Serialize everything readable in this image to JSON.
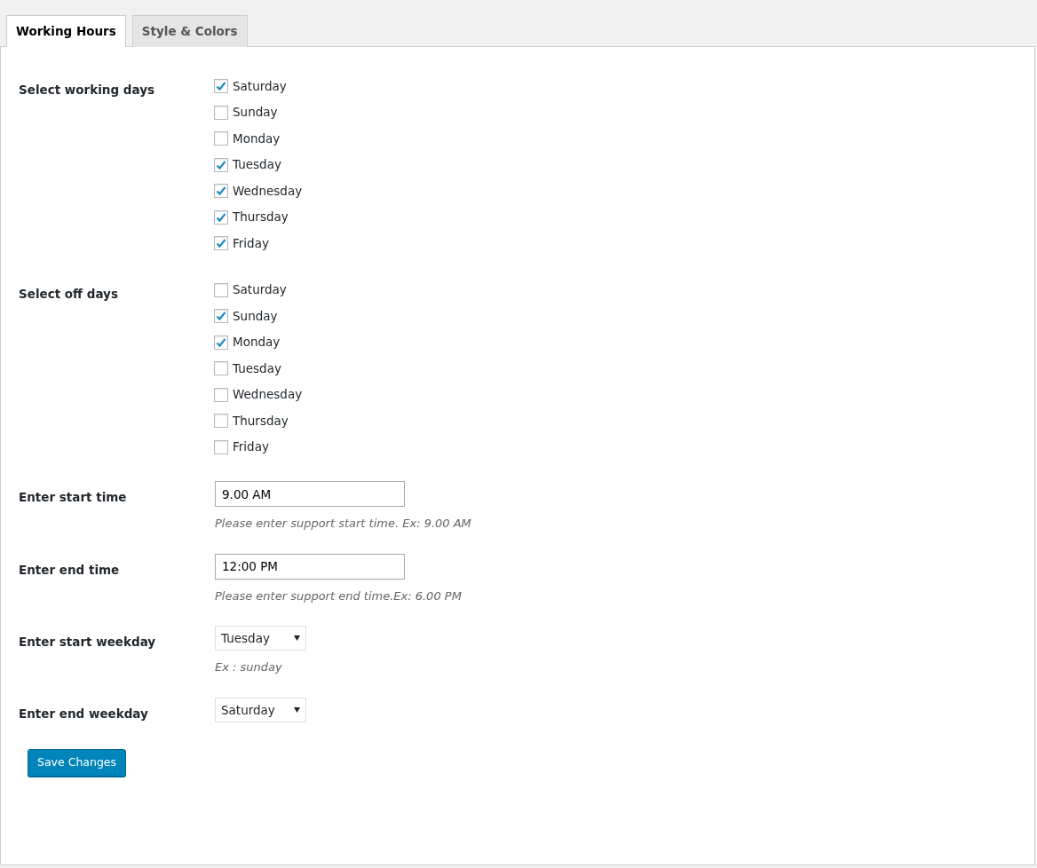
{
  "tabs": [
    {
      "label": "Working Hours",
      "selected": true
    },
    {
      "label": "Style & Colors",
      "selected": false
    }
  ],
  "fields": [
    {
      "kind": "checkboxes",
      "label": "Select working days",
      "options": [
        {
          "label": "Saturday",
          "checked": true
        },
        {
          "label": "Sunday",
          "checked": false
        },
        {
          "label": "Monday",
          "checked": false
        },
        {
          "label": "Tuesday",
          "checked": true
        },
        {
          "label": "Wednesday",
          "checked": true
        },
        {
          "label": "Thursday",
          "checked": true
        },
        {
          "label": "Friday",
          "checked": true
        }
      ]
    },
    {
      "kind": "checkboxes",
      "label": "Select off days",
      "options": [
        {
          "label": "Saturday",
          "checked": false
        },
        {
          "label": "Sunday",
          "checked": true
        },
        {
          "label": "Monday",
          "checked": true
        },
        {
          "label": "Tuesday",
          "checked": false
        },
        {
          "label": "Wednesday",
          "checked": false
        },
        {
          "label": "Thursday",
          "checked": false
        },
        {
          "label": "Friday",
          "checked": false
        }
      ]
    },
    {
      "kind": "text",
      "label": "Enter start time",
      "value": "9.00 AM",
      "help": "Please enter support start time. Ex: 9.00 AM"
    },
    {
      "kind": "text",
      "label": "Enter end time",
      "value": "12:00 PM",
      "help": "Please enter support end time.Ex: 6.00 PM"
    },
    {
      "kind": "select",
      "label": "Enter start weekday",
      "value": "Tuesday",
      "help": "Ex : sunday"
    },
    {
      "kind": "select",
      "label": "Enter end weekday",
      "value": "Saturday"
    }
  ],
  "save_button": "Save Changes"
}
